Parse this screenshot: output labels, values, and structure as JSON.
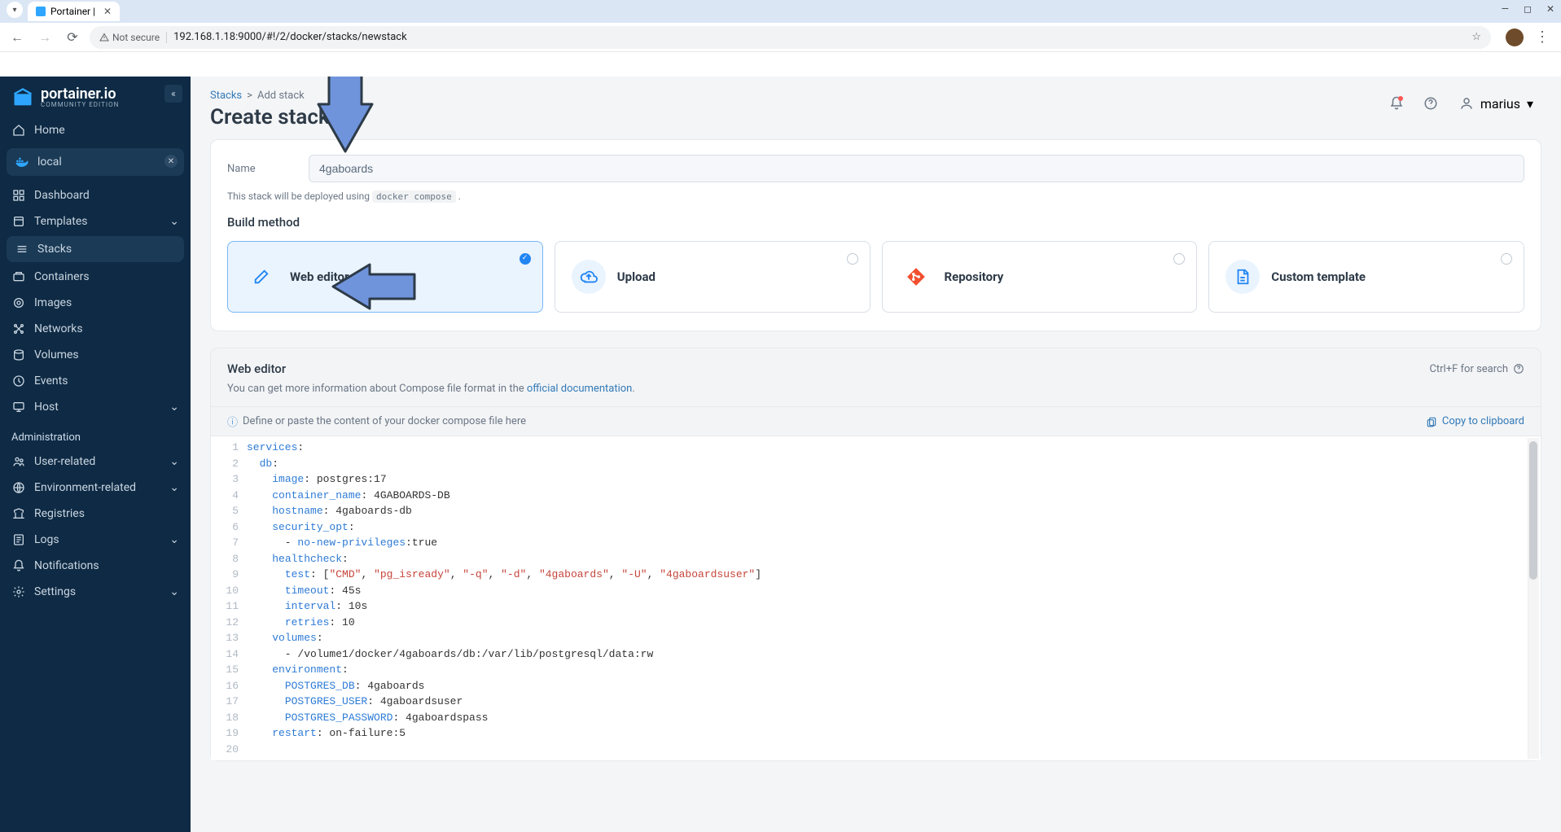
{
  "browser": {
    "tab_title": "Portainer |",
    "not_secure_label": "Not secure",
    "url": "192.168.1.18:9000/#!/2/docker/stacks/newstack"
  },
  "brand": {
    "name": "portainer.io",
    "sub": "COMMUNITY EDITION"
  },
  "sidebar": {
    "home": "Home",
    "env_label": "local",
    "items": [
      {
        "label": "Dashboard",
        "icon": "dashboard"
      },
      {
        "label": "Templates",
        "icon": "templates",
        "chevron": true
      },
      {
        "label": "Stacks",
        "icon": "stacks",
        "active": true
      },
      {
        "label": "Containers",
        "icon": "containers"
      },
      {
        "label": "Images",
        "icon": "images"
      },
      {
        "label": "Networks",
        "icon": "networks"
      },
      {
        "label": "Volumes",
        "icon": "volumes"
      },
      {
        "label": "Events",
        "icon": "events"
      },
      {
        "label": "Host",
        "icon": "host",
        "chevron": true
      }
    ],
    "admin_header": "Administration",
    "admin_items": [
      {
        "label": "User-related",
        "icon": "users",
        "chevron": true
      },
      {
        "label": "Environment-related",
        "icon": "env",
        "chevron": true
      },
      {
        "label": "Registries",
        "icon": "registries"
      },
      {
        "label": "Logs",
        "icon": "logs",
        "chevron": true
      },
      {
        "label": "Notifications",
        "icon": "bell"
      },
      {
        "label": "Settings",
        "icon": "gear",
        "chevron": true
      }
    ]
  },
  "header": {
    "breadcrumb_stacks": "Stacks",
    "breadcrumb_sep": ">",
    "breadcrumb_current": "Add stack",
    "page_title": "Create stack",
    "user_name": "marius"
  },
  "form": {
    "name_label": "Name",
    "name_value": "4gaboards",
    "deploy_note_pre": "This stack will be deployed using ",
    "deploy_note_code": "docker compose",
    "deploy_note_post": "."
  },
  "build": {
    "section_title": "Build method",
    "methods": [
      {
        "label": "Web editor",
        "selected": true,
        "icon": "edit"
      },
      {
        "label": "Upload",
        "icon": "upload"
      },
      {
        "label": "Repository",
        "icon": "git"
      },
      {
        "label": "Custom template",
        "icon": "file"
      }
    ]
  },
  "editor": {
    "title": "Web editor",
    "search_hint": "Ctrl+F for search",
    "sub_pre": "You can get more information about Compose file format in the ",
    "sub_link": "official documentation",
    "sub_post": ".",
    "define_hint": "Define or paste the content of your docker compose file here",
    "copy_label": "Copy to clipboard",
    "lines": [
      "services:",
      "  db:",
      "    image: postgres:17",
      "    container_name: 4GABOARDS-DB",
      "    hostname: 4gaboards-db",
      "    security_opt:",
      "      - no-new-privileges:true",
      "    healthcheck:",
      "      test: [\"CMD\", \"pg_isready\", \"-q\", \"-d\", \"4gaboards\", \"-U\", \"4gaboardsuser\"]",
      "      timeout: 45s",
      "      interval: 10s",
      "      retries: 10",
      "    volumes:",
      "      - /volume1/docker/4gaboards/db:/var/lib/postgresql/data:rw",
      "    environment:",
      "      POSTGRES_DB: 4gaboards",
      "      POSTGRES_USER: 4gaboardsuser",
      "      POSTGRES_PASSWORD: 4gaboardspass",
      "    restart: on-failure:5",
      ""
    ]
  }
}
